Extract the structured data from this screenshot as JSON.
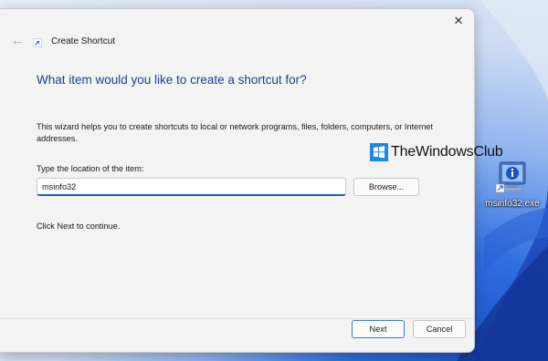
{
  "dialog": {
    "title": "Create Shortcut",
    "close_label": "✕",
    "back_label": "←",
    "heading": "What item would you like to create a shortcut for?",
    "description": "This wizard helps you to create shortcuts to local or network programs, files, folders, computers, or Internet addresses.",
    "field_label": "Type the location of the item:",
    "location_value": "msinfo32",
    "browse_label": "Browse...",
    "continue_text": "Click Next to continue.",
    "next_label": "Next",
    "cancel_label": "Cancel"
  },
  "watermark": {
    "text": "TheWindowsClub"
  },
  "desktop_icon": {
    "label": "msinfo32.exe",
    "icon": "system-information-icon"
  },
  "colors": {
    "accent": "#1f5fbf",
    "heading": "#1f3f8c",
    "dialog_bg": "#f3f3f3",
    "watermark_logo": "#1e88e5"
  }
}
